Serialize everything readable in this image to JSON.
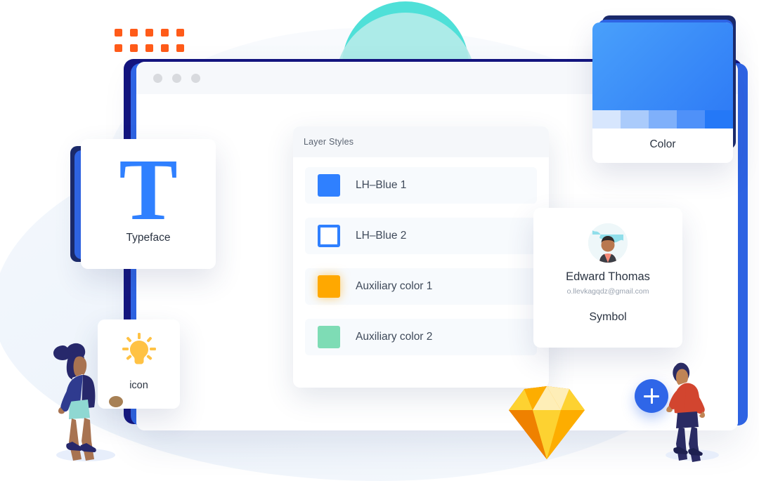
{
  "window": {
    "name": "browser-window-mockup",
    "dots": [
      "dot-red",
      "dot-yellow",
      "dot-green"
    ]
  },
  "layer_styles_panel": {
    "title": "Layer Styles",
    "rows": [
      {
        "label": "LH–Blue 1",
        "swatch": "#2f80ff",
        "style": "solid"
      },
      {
        "label": "LH–Blue 2",
        "swatch": "#2f80ff",
        "style": "hollow"
      },
      {
        "label": "Auxiliary color 1",
        "swatch": "#ffa800",
        "style": "glow"
      },
      {
        "label": "Auxiliary color 2",
        "swatch": "#7edcb5",
        "style": "solid"
      }
    ]
  },
  "typeface_card": {
    "glyph": "T",
    "caption": "Typeface",
    "color": "#2f80ff"
  },
  "icon_card": {
    "icon": "lightbulb-icon",
    "caption": "icon",
    "color": "#ffc244"
  },
  "color_card": {
    "caption": "Color",
    "gradient_from": "#49a0fb",
    "gradient_to": "#2f7cf6",
    "swatches": [
      "#d7e6fd",
      "#aacbfb",
      "#7fb0fa",
      "#4f91f9",
      "#2478f7"
    ]
  },
  "symbol_card": {
    "caption": "Symbol",
    "user_name": "Edward Thomas",
    "user_email": "o.llevkagqdz@gmail.com",
    "avatar": "user-avatar-photo"
  },
  "fab": {
    "name": "add-button",
    "icon": "plus-icon",
    "color": "#2f66e8"
  },
  "decor": {
    "sketch_logo": "sketch-diamond-logo",
    "dot_grid_color": "#ff5b19",
    "dot_grid_count": 10,
    "arc_color_front": "#b4ece9",
    "arc_color_back": "#4fe0d8",
    "person_left": "walking-woman-illustration",
    "person_right": "walking-man-illustration"
  }
}
